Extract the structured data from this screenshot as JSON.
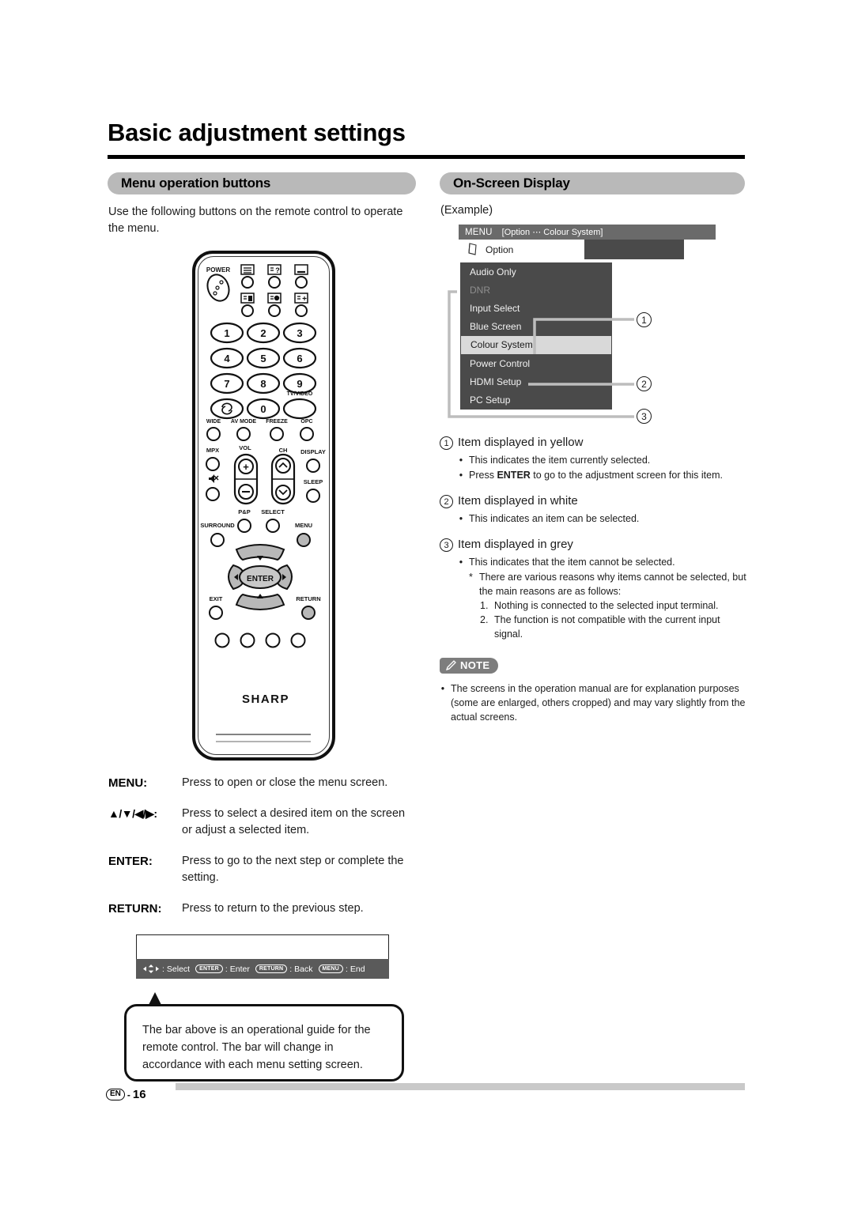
{
  "page": {
    "title": "Basic adjustment settings",
    "footer": {
      "language_badge": "EN",
      "dash": "-",
      "page_number": "16"
    }
  },
  "sections": {
    "left_header": "Menu operation buttons",
    "right_header": "On-Screen Display"
  },
  "left": {
    "intro": "Use the following buttons on the remote control to operate the menu.",
    "remote": {
      "power_label": "POWER",
      "teletext_icons": [
        "teletext-index-icon",
        "teletext-reveal-icon",
        "teletext-subtitle-icon",
        "teletext-subpage-icon",
        "teletext-hold-icon",
        "teletext-size-icon"
      ],
      "numeric_keys": [
        "1",
        "2",
        "3",
        "4",
        "5",
        "6",
        "7",
        "8",
        "9",
        "0"
      ],
      "flashback_label": "flashback-icon",
      "tv_video_label": "TV/VIDEO",
      "row_wide": [
        "WIDE",
        "AV MODE",
        "FREEZE",
        "OPC"
      ],
      "mpx_label": "MPX",
      "mute_label": "mute-icon",
      "vol_label": "VOL",
      "vol_plus": "+",
      "vol_minus": "−",
      "ch_label": "CH",
      "display_label": "DISPLAY",
      "sleep_label": "SLEEP",
      "pp_label": "P&P",
      "select_label": "SELECT",
      "surround_label": "SURROUND",
      "menu_label": "MENU",
      "enter_label": "ENTER",
      "exit_label": "EXIT",
      "return_label": "RETURN",
      "brand": "SHARP"
    },
    "button_descriptions": [
      {
        "key": "MENU:",
        "value": "Press to open or close the menu screen."
      },
      {
        "key": "▲/▼/◀/▶:",
        "value": "Press to select a desired item on the screen or adjust a selected item."
      },
      {
        "key": "ENTER:",
        "value": "Press to go to the next step or complete the setting."
      },
      {
        "key": "RETURN:",
        "value": "Press to return to the previous step."
      }
    ],
    "guide_bar": {
      "select_label": "Select",
      "enter_key": "ENTER",
      "enter_label": "Enter",
      "return_key": "RETURN",
      "return_label": "Back",
      "menu_key": "MENU",
      "menu_label": "End",
      "colon": ":"
    },
    "balloon": "The bar above is an operational guide for the remote control. The bar will change in accordance with each menu setting screen."
  },
  "right": {
    "example_label": "(Example)",
    "osd": {
      "titlebar_menu": "MENU",
      "titlebar_path": "[Option ⋯ Colour System]",
      "tab_label": "Option",
      "tab_icon": "option-book-icon",
      "items": [
        {
          "label": "Audio Only",
          "state": "white"
        },
        {
          "label": "DNR",
          "state": "grey"
        },
        {
          "label": "Input Select",
          "state": "white"
        },
        {
          "label": "Blue Screen",
          "state": "white"
        },
        {
          "label": "Colour System",
          "state": "selected"
        },
        {
          "label": "Power Control",
          "state": "white"
        },
        {
          "label": "HDMI Setup",
          "state": "white"
        },
        {
          "label": "PC Setup",
          "state": "white"
        }
      ],
      "callouts": [
        "1",
        "2",
        "3"
      ]
    },
    "descriptions": [
      {
        "num": "1",
        "heading": "Item displayed in yellow",
        "bullets": [
          {
            "text": "This indicates the item currently selected."
          },
          {
            "pre": "Press ",
            "bold": "ENTER",
            "post": " to go to the adjustment screen for this item."
          }
        ]
      },
      {
        "num": "2",
        "heading": "Item displayed in white",
        "bullets": [
          {
            "text": "This indicates an item can be selected."
          }
        ]
      },
      {
        "num": "3",
        "heading": "Item displayed in grey",
        "bullets": [
          {
            "text": "This indicates that the item cannot be selected."
          }
        ],
        "star_note": "There are various reasons why items cannot be selected, but the main reasons are as follows:",
        "numbered": [
          {
            "n": "1.",
            "text": "Nothing is connected to the selected input terminal."
          },
          {
            "n": "2.",
            "text": "The function is not compatible with the current input signal."
          }
        ]
      }
    ],
    "note": {
      "badge_label": "NOTE",
      "badge_icon": "pencil-icon",
      "bullet": "The screens in the operation manual are for explanation purposes (some are enlarged, others cropped) and may vary slightly from the actual screens."
    }
  },
  "colors": {
    "pill_grey": "#b9b9b9",
    "osd_panel": "#4a4a4a",
    "osd_titlebar": "#6a6a6a",
    "osd_selected": "#d9d9d9",
    "osd_disabled_text": "#8e8e8e",
    "note_badge": "#7d7d7d",
    "guide_bar": "#5a5a5a",
    "rule": "#000000"
  }
}
